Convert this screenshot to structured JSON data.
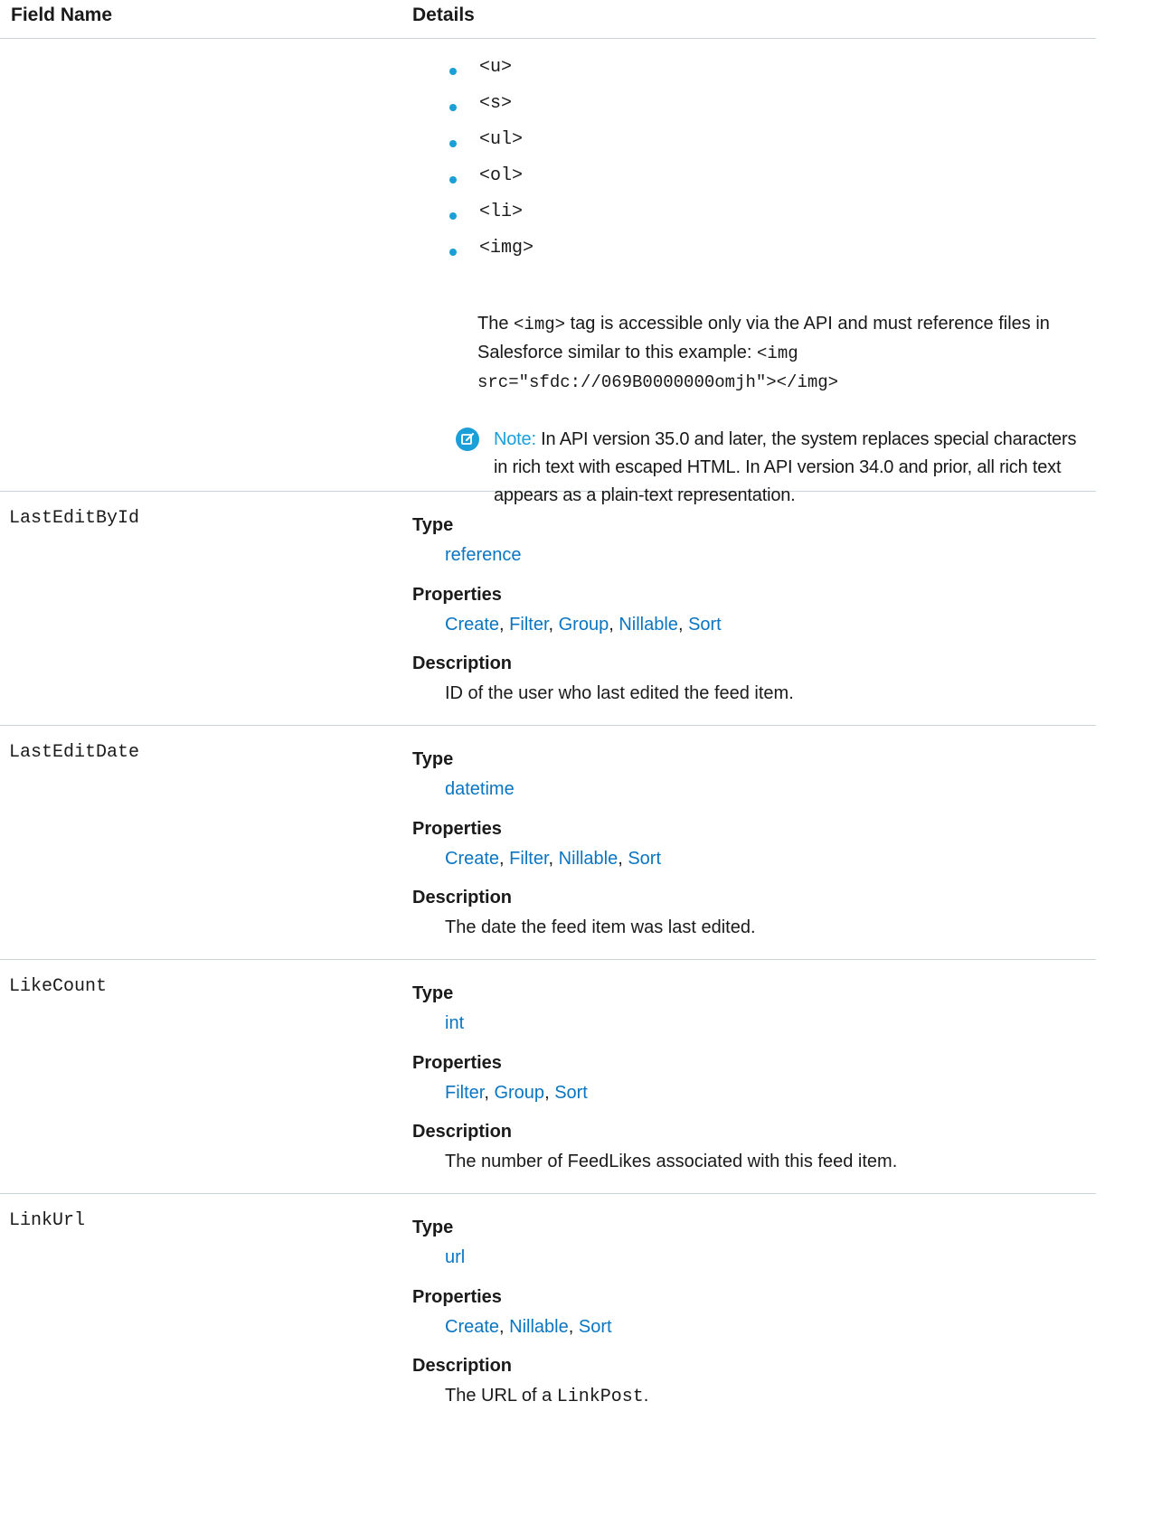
{
  "header": {
    "field_name": "Field Name",
    "details": "Details"
  },
  "continuation": {
    "tags": [
      "<u>",
      "<s>",
      "<ul>",
      "<ol>",
      "<li>",
      "<img>"
    ],
    "img_note": {
      "pre": "The",
      "tag": "<img>",
      "mid": "tag is accessible only via the API and must reference files in Salesforce similar to this example:",
      "example_line1": "<img",
      "example_line2": "src=\"sfdc://069B0000000omjh\"></img>"
    },
    "note": {
      "label": "Note:",
      "text": "In API version 35.0 and later, the system replaces special characters in rich text with escaped HTML. In API version 34.0 and prior, all rich text appears as a plain-text representation.",
      "icon": "edit-note-icon"
    }
  },
  "labels": {
    "type": "Type",
    "properties": "Properties",
    "description": "Description"
  },
  "fields": [
    {
      "name": "LastEditById",
      "type": "reference",
      "properties": [
        "Create",
        "Filter",
        "Group",
        "Nillable",
        "Sort"
      ],
      "description": "ID of the user who last edited the feed item."
    },
    {
      "name": "LastEditDate",
      "type": "datetime",
      "properties": [
        "Create",
        "Filter",
        "Nillable",
        "Sort"
      ],
      "description": "The date the feed item was last edited."
    },
    {
      "name": "LikeCount",
      "type": "int",
      "properties": [
        "Filter",
        "Group",
        "Sort"
      ],
      "description": "The number of FeedLikes associated with this feed item."
    },
    {
      "name": "LinkUrl",
      "type": "url",
      "properties": [
        "Create",
        "Nillable",
        "Sort"
      ],
      "description_pre": "The URL of a",
      "description_code": "LinkPost",
      "description_post": "."
    }
  ],
  "colors": {
    "accent": "#1a9fd9",
    "link": "#0a75c2",
    "divider": "#c9d4d8"
  }
}
